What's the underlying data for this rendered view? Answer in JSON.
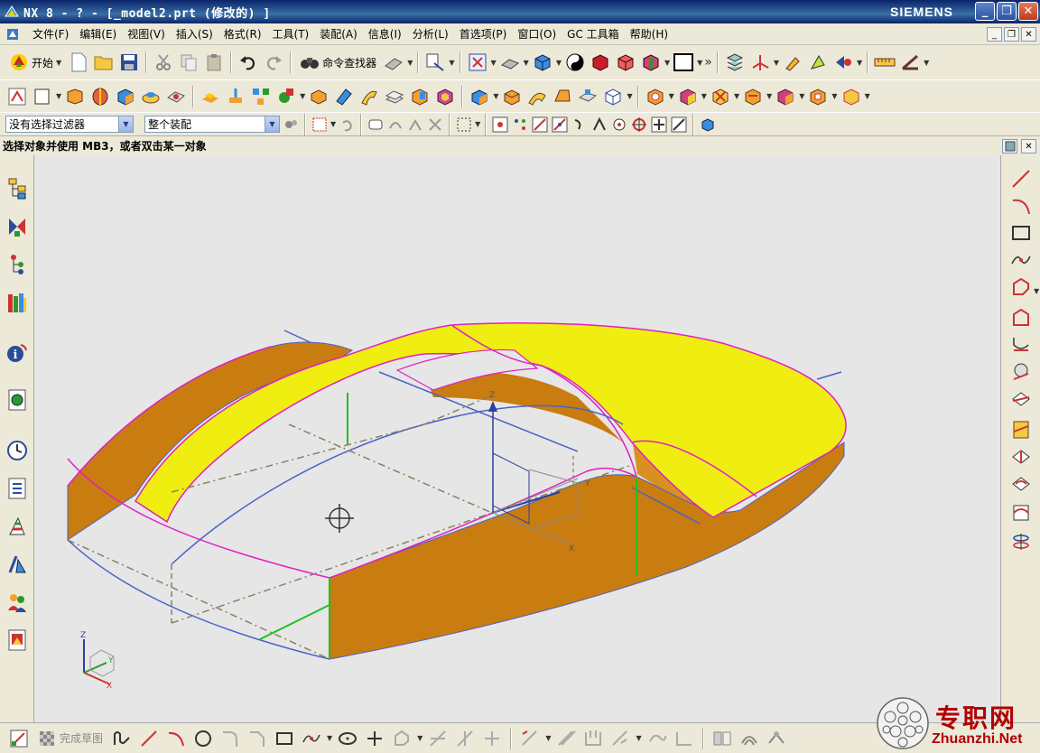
{
  "window": {
    "title": "NX 8 - ? - [_model2.prt (修改的) ]",
    "brand": "SIEMENS",
    "minimize_glyph": "_",
    "restore_glyph": "❐",
    "close_glyph": "✕"
  },
  "menubar": {
    "items": [
      "文件(F)",
      "编辑(E)",
      "视图(V)",
      "插入(S)",
      "格式(R)",
      "工具(T)",
      "装配(A)",
      "信息(I)",
      "分析(L)",
      "首选项(P)",
      "窗口(O)",
      "GC 工具箱",
      "帮助(H)"
    ]
  },
  "toolbar": {
    "start_label": "开始",
    "command_finder_label": "命令查找器",
    "overflow_glyph": "»"
  },
  "selection": {
    "filter_value": "没有选择过滤器",
    "scope_value": "整个装配"
  },
  "cue_line": "选择对象并使用 MB3，或者双击某一对象",
  "bottombar": {
    "finish_sketch_label": "完成草图"
  },
  "watermark": {
    "cn": "专职网",
    "en": "Zhuanzhi.Net"
  },
  "colors": {
    "top_face": "#f0ee10",
    "side_face": "#c97c10",
    "edge_magenta": "#e020c0",
    "sketch_blue": "#4a62c8",
    "edge_green": "#20c020",
    "hidden_dash": "#8a8060",
    "background": "#e6e6e6"
  },
  "graphics": {
    "csys_labels": {
      "z": "Z",
      "y": "Y",
      "x": "X"
    },
    "triad_labels": {
      "z": "Z",
      "y": "Y",
      "x": "X"
    }
  }
}
